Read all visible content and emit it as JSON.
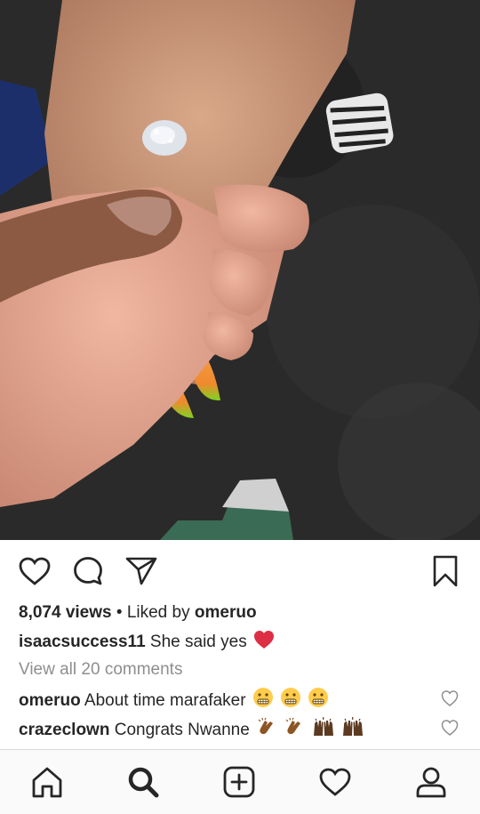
{
  "post": {
    "views": "8,074 views",
    "liked_by_prefix": "Liked by",
    "liked_by_user": "omeruo",
    "caption_user": "isaacsuccess11",
    "caption_text": "She said yes",
    "view_all_comments": "View all 20 comments",
    "separator": "•"
  },
  "comments": [
    {
      "user": "omeruo",
      "text": "About time marafaker",
      "emoji": "grimacing-face-x3"
    },
    {
      "user": "crazeclown",
      "text": "Congrats Nwanne",
      "emoji": "clapping-hands-x2-raising-hands-x2"
    }
  ],
  "icons": {
    "like": "heart-outline-icon",
    "comment": "speech-bubble-icon",
    "share": "paper-plane-icon",
    "save": "bookmark-icon",
    "nav": [
      "home-icon",
      "search-icon",
      "add-post-icon",
      "activity-heart-icon",
      "profile-icon"
    ]
  },
  "colors": {
    "accent_red": "#ed4956",
    "muted": "#8e8e8e",
    "text": "#262626"
  }
}
